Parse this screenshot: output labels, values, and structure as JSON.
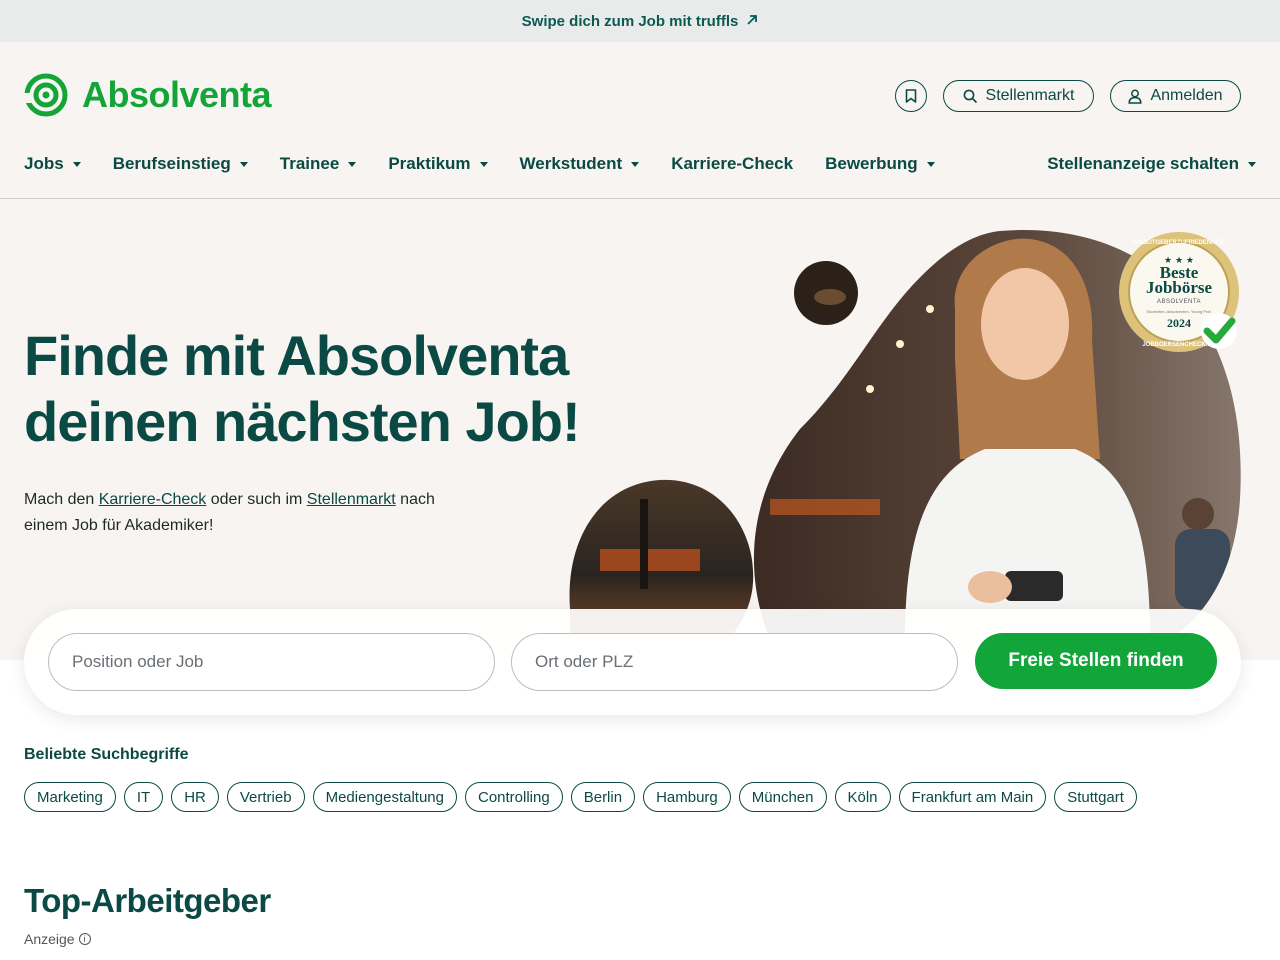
{
  "topbar": {
    "text": "Swipe dich zum Job mit truffls",
    "arrow_icon": "arrow-up-right-icon"
  },
  "brand": {
    "name": "Absolventa",
    "color": "#13a538"
  },
  "header": {
    "bookmark_icon": "bookmark-icon",
    "stellenmarkt_label": "Stellenmarkt",
    "anmelden_label": "Anmelden"
  },
  "nav": {
    "items": [
      {
        "label": "Jobs",
        "dropdown": true
      },
      {
        "label": "Berufseinstieg",
        "dropdown": true
      },
      {
        "label": "Trainee",
        "dropdown": true
      },
      {
        "label": "Praktikum",
        "dropdown": true
      },
      {
        "label": "Werkstudent",
        "dropdown": true
      },
      {
        "label": "Karriere-Check",
        "dropdown": false
      },
      {
        "label": "Bewerbung",
        "dropdown": true
      }
    ],
    "right_label": "Stellenanzeige schalten"
  },
  "hero": {
    "title_line1": "Finde mit Absolventa",
    "title_line2": "deinen nächsten Job!",
    "sub_part1": "Mach den ",
    "sub_link1": "Karriere-Check",
    "sub_part2": " oder such im ",
    "sub_link2": "Stellenmarkt",
    "sub_part3": " nach einem Job für Akademiker!"
  },
  "badge": {
    "ring_text": "ARBEITGEBERZUFRIEDENHEIT · JOBBOERSENCHECK.DE",
    "line1": "Beste",
    "line2": "Jobbörse",
    "brand": "ABSOLVENTA",
    "small": "Studenten, Absolventen, Young Prof.",
    "year": "2024"
  },
  "search": {
    "position_placeholder": "Position oder Job",
    "location_placeholder": "Ort oder PLZ",
    "button_label": "Freie Stellen finden"
  },
  "popular": {
    "title": "Beliebte Suchbegriffe",
    "chips": [
      "Marketing",
      "IT",
      "HR",
      "Vertrieb",
      "Mediengestaltung",
      "Controlling",
      "Berlin",
      "Hamburg",
      "München",
      "Köln",
      "Frankfurt am Main",
      "Stuttgart"
    ]
  },
  "top_employers": {
    "title": "Top-Arbeitgeber",
    "ad_label": "Anzeige"
  },
  "colors": {
    "accent": "#12a53a",
    "text_dark": "#0b4a44",
    "hero_bg": "#f7f4f1"
  }
}
